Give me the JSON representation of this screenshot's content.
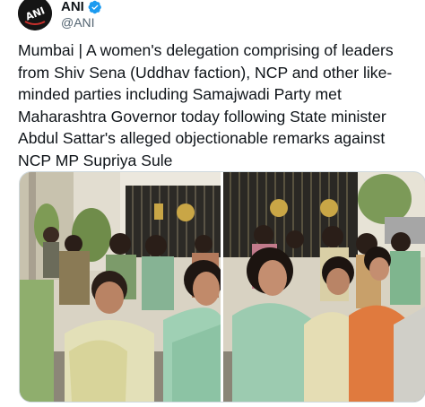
{
  "account": {
    "display_name": "ANI",
    "handle": "@ANI",
    "avatar_text": "ANI",
    "verified": true
  },
  "tweet": {
    "text": "Mumbai | A women's delegation comprising of leaders from Shiv Sena (Uddhav faction), NCP and other like-minded parties including Samajwadi Party met Maharashtra Governor today following State minister Abdul Sattar's alleged objectionable remarks against NCP MP Supriya Sule"
  },
  "media": {
    "image_count": 2,
    "images": [
      {
        "name": "left-photo"
      },
      {
        "name": "right-photo"
      }
    ]
  },
  "colors": {
    "verified_blue": "#1d9bf0",
    "handle_gray": "#536471",
    "text": "#0f1419",
    "border": "#cfd9de"
  }
}
